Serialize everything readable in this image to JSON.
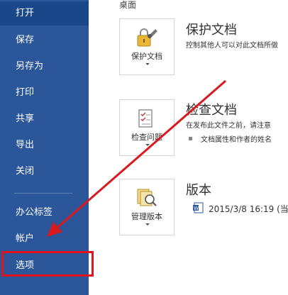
{
  "sidebar": {
    "items": [
      {
        "label": "打开"
      },
      {
        "label": "保存"
      },
      {
        "label": "另存为"
      },
      {
        "label": "打印"
      },
      {
        "label": "共享"
      },
      {
        "label": "导出"
      },
      {
        "label": "关闭"
      },
      {
        "label": "办公标签"
      },
      {
        "label": "帐户"
      },
      {
        "label": "选项"
      }
    ]
  },
  "main": {
    "location_label": "桌面",
    "protect": {
      "tile_label": "保护文档",
      "title": "保护文档",
      "description": "控制其他人可以对此文档所做"
    },
    "inspect": {
      "tile_label": "检查问题",
      "title": "检查文档",
      "description": "在发布此文件之前，请注意",
      "bullet": "文档属性和作者的姓名"
    },
    "versions": {
      "tile_label": "管理版本",
      "title": "版本",
      "entry": "2015/3/8 16:19 (当"
    }
  },
  "colors": {
    "sidebar": "#2b579a",
    "annotation": "#e0141e"
  }
}
